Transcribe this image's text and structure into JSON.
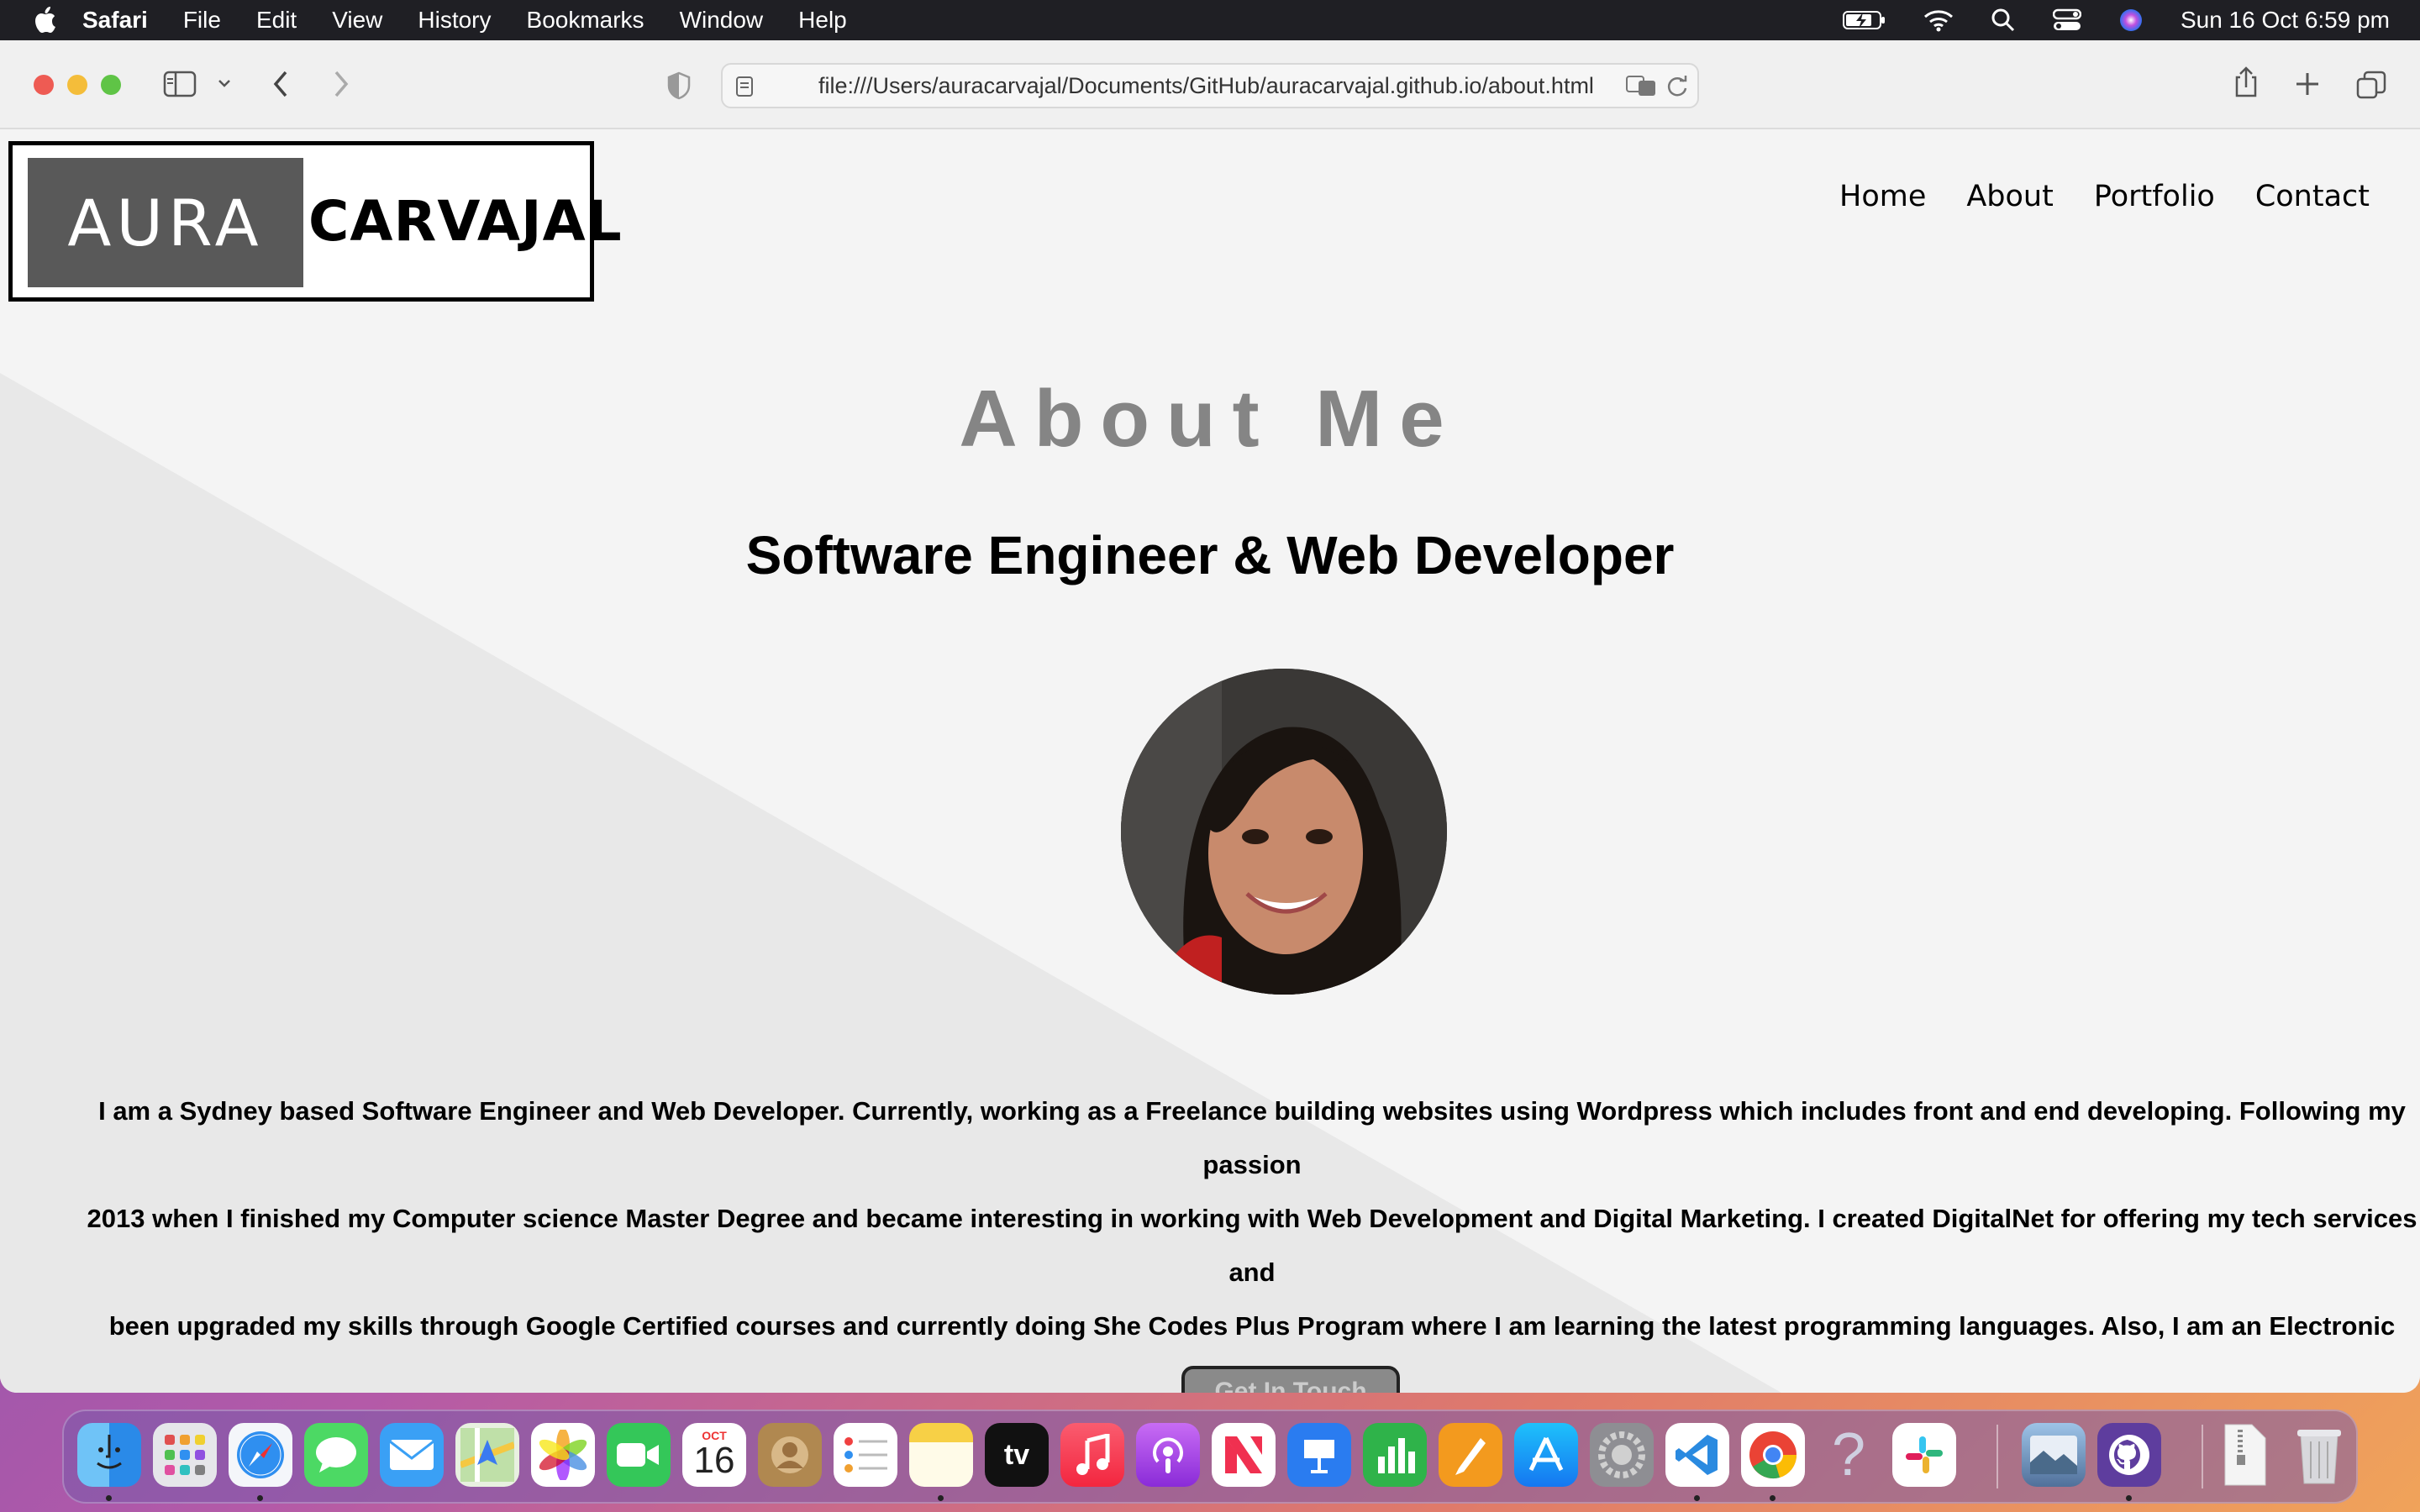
{
  "menubar": {
    "app": "Safari",
    "items": [
      "File",
      "Edit",
      "View",
      "History",
      "Bookmarks",
      "Window",
      "Help"
    ],
    "datetime": "Sun 16 Oct  6:59 pm"
  },
  "browser": {
    "url": "file:///Users/auracarvajal/Documents/GitHub/auracarvajal.github.io/about.html"
  },
  "site": {
    "logo": {
      "left": "AURA",
      "right": "CARVAJAL"
    },
    "nav": [
      "Home",
      "About",
      "Portfolio",
      "Contact"
    ],
    "title": "About Me",
    "subtitle": "Software Engineer & Web Developer",
    "bio": "I am a Sydney based Software Engineer and Web Developer. Currently, working as a Freelance building websites using Wordpress which includes front and end developing. Following my passion\n2013 when I finished my Computer science Master Degree and became interesting in working with Web Development and Digital Marketing. I created DigitalNet for offering my tech services and\nbeen upgraded my skills through Google Certified courses and currently doing She Codes Plus Program where I am learning the latest programming languages. Also, I am an Electronic Engineer\nworked for couple of years on it but I decided to follow my passion that I found in tech.",
    "cta": "Get In Touch"
  },
  "dock": {
    "calendar_month": "OCT",
    "calendar_day": "16",
    "tv_label": "tv"
  },
  "colors": {
    "title": "#858585",
    "menubar": "#1f1f24",
    "page_bg": "#f4f4f4"
  }
}
